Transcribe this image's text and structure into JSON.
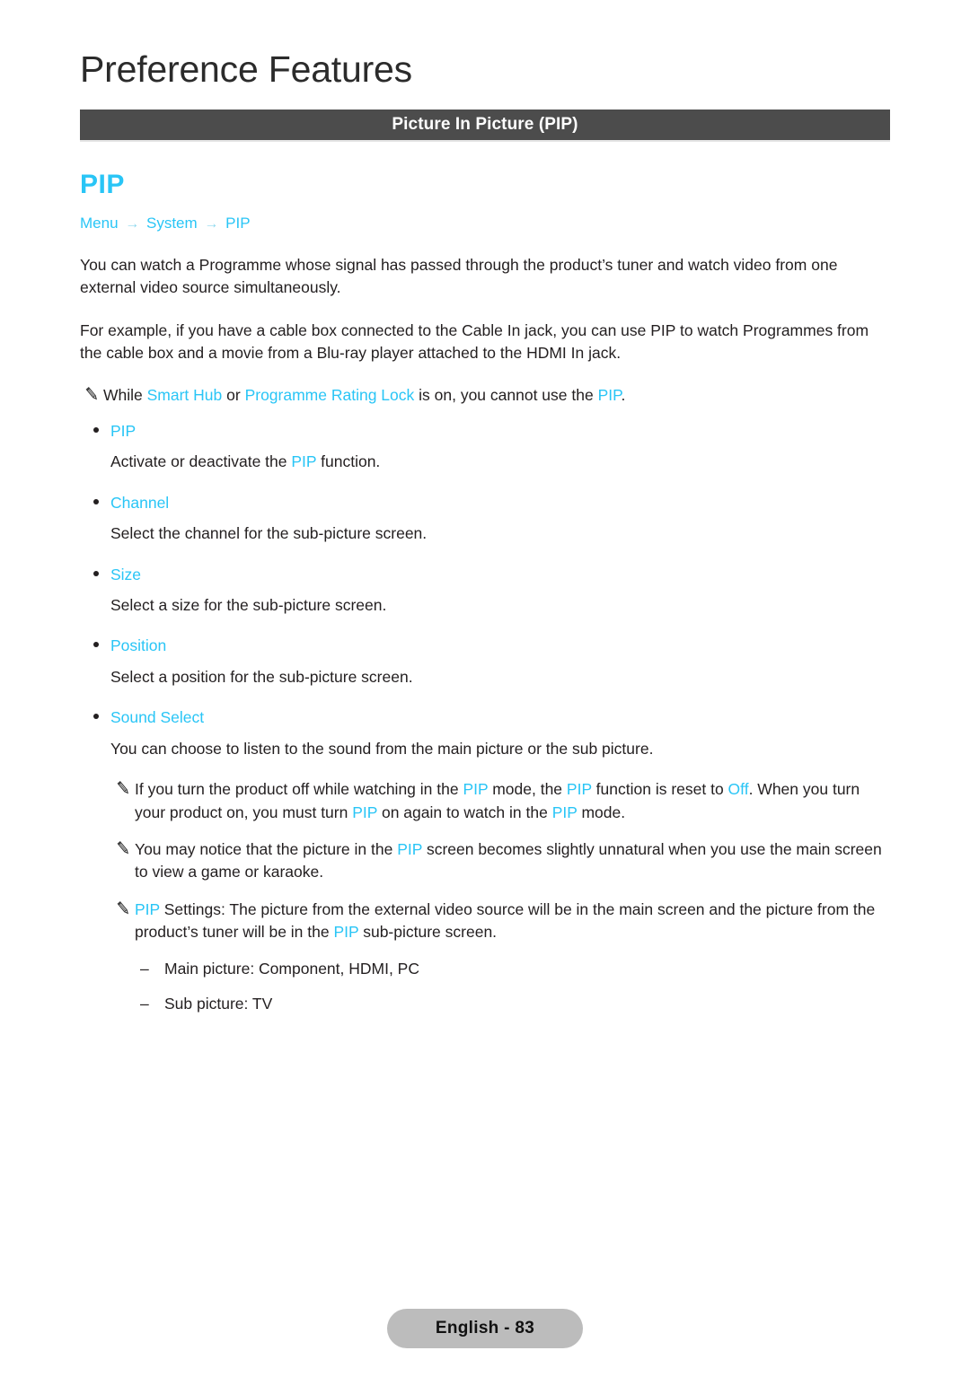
{
  "page": {
    "chapter_title": "Preference Features",
    "section_bar_label": "Picture In Picture (PIP)",
    "feature_heading": "PIP",
    "footer_label": "English - 83"
  },
  "colors": {
    "accent_cyan": "#29c5f6",
    "section_bar_bg": "#4c4c4c",
    "body_text": "#231f20",
    "footer_pill_bg": "#bcbcbc"
  },
  "breadcrumb": {
    "items": [
      "Menu",
      "System",
      "PIP"
    ],
    "separator": "→"
  },
  "paragraphs": {
    "intro": "You can watch a Programme whose signal has passed through the product’s tuner and watch video from one external video source simultaneously.",
    "example": "For example, if you have a cable box connected to the Cable In jack, you can use PIP to watch Programmes from the cable box and a movie from a Blu-ray player attached to the HDMI In jack."
  },
  "notes": {
    "smart_hub": {
      "pre": "While ",
      "link1": "Smart Hub",
      "mid": " or ",
      "link2": "Programme Rating Lock",
      "post": " is on, you cannot use the ",
      "link3": "PIP",
      "end": "."
    },
    "power_off": {
      "t1": "If you turn the product off while watching in the ",
      "h1": "PIP",
      "t2": " mode, the ",
      "h2": "PIP",
      "t3": " function is reset to ",
      "h3": "Off",
      "t4": ". When you turn your product on, you must turn ",
      "h4": "PIP",
      "t5": " on again to watch in the ",
      "h5": "PIP",
      "t6": " mode."
    },
    "unnatural": {
      "t1": "You may notice that the picture in the ",
      "h1": "PIP",
      "t2": " screen becomes slightly unnatural when you use the main screen to view a game or karaoke."
    },
    "settings": {
      "h1": "PIP",
      "t1": " Settings: The picture from the external video source will be in the main screen and the picture from the product’s tuner will be in the ",
      "h2": "PIP",
      "t2": " sub-picture screen."
    }
  },
  "options": [
    {
      "label": "PIP",
      "desc_pre": "Activate or deactivate the ",
      "desc_hl": "PIP",
      "desc_post": " function."
    },
    {
      "label": "Channel",
      "desc_pre": "Select the channel for the sub-picture screen.",
      "desc_hl": "",
      "desc_post": ""
    },
    {
      "label": "Size",
      "desc_pre": "Select a size for the sub-picture screen.",
      "desc_hl": "",
      "desc_post": ""
    },
    {
      "label": "Position",
      "desc_pre": "Select a position for the sub-picture screen.",
      "desc_hl": "",
      "desc_post": ""
    },
    {
      "label": "Sound Select",
      "desc_pre": "You can choose to listen to the sound from the main picture or the sub picture.",
      "desc_hl": "",
      "desc_post": ""
    }
  ],
  "dash_items": [
    {
      "mark": "–",
      "text": "Main picture: Component, HDMI, PC"
    },
    {
      "mark": "–",
      "text": "Sub picture: TV"
    }
  ]
}
